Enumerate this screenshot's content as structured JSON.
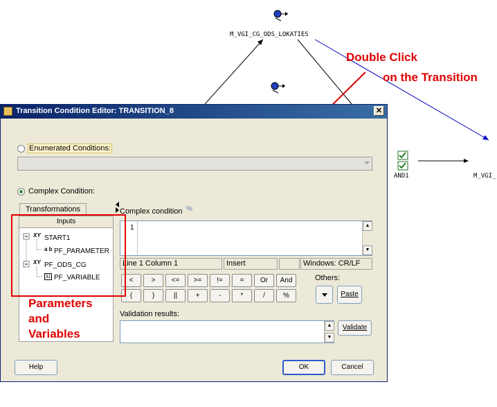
{
  "canvas": {
    "node_top_label": "M_VGI_CG_ODS_LOKATIES",
    "and_label": "AND1",
    "right_label": "M_VGI_"
  },
  "callouts": {
    "double_click": "Double Click",
    "on_transition": "on the Transition",
    "params": [
      "Parameters",
      "and",
      "Variables"
    ]
  },
  "dialog": {
    "title": "Transition Condition Editor: TRANSITION_8",
    "close": "✕",
    "enumerated_label": "Enumerated Conditions:",
    "complex_label": "Complex Condition:",
    "tabs": {
      "transformations": "Transformations",
      "inputs": "Inputs"
    },
    "tree": [
      {
        "label": "START1"
      },
      {
        "label": "PF_PARAMETER"
      },
      {
        "label": "PF_ODS_CG"
      },
      {
        "label": "PF_VARIABLE"
      }
    ],
    "editor_title": "Complex condition",
    "line_number": "1",
    "status": {
      "position": "Line 1 Column 1",
      "mode": "Insert",
      "eol": "Windows: CR/LF"
    },
    "operators_row1": [
      "<",
      ">",
      "<=",
      ">=",
      "!=",
      "=",
      "Or",
      "And"
    ],
    "operators_row2": [
      "(",
      ")",
      "||",
      "+",
      "-",
      "*",
      "/",
      "%"
    ],
    "others_label": "Others:",
    "paste": "Paste",
    "validation_label": "Validation results:",
    "validate": "Validate",
    "help": "Help",
    "ok": "OK",
    "cancel": "Cancel"
  }
}
